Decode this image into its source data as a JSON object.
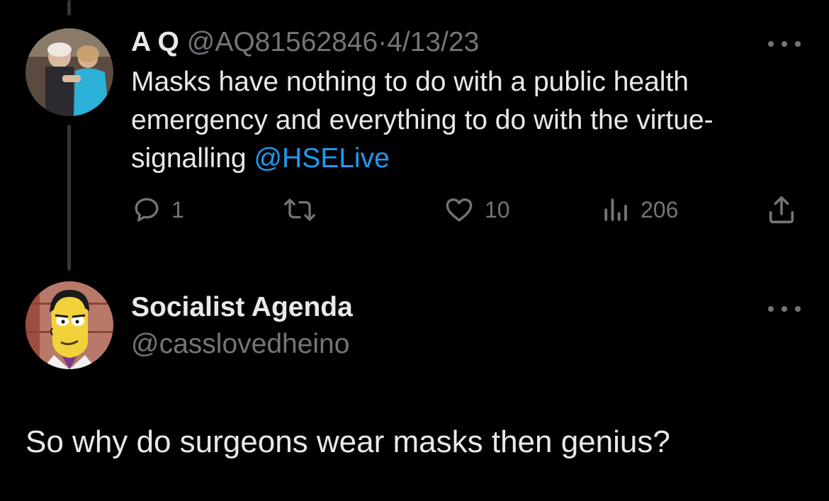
{
  "parent_tweet": {
    "author_name": "A Q",
    "handle": "@AQ81562846",
    "separator": "·",
    "date": "4/13/23",
    "text_before_mention": "Masks have nothing to do with a public health emergency and everything to do with the virtue-signalling",
    "mention": "@HSELive",
    "stats": {
      "replies": "1",
      "likes": "10",
      "views": "206"
    }
  },
  "reply_tweet": {
    "author_name": "Socialist Agenda",
    "handle": "@casslovedheino",
    "text": "So why do surgeons wear masks then genius?"
  },
  "icons": {
    "more": "more-horizontal-icon",
    "reply": "reply-bubble-icon",
    "retweet": "retweet-icon",
    "like": "heart-icon",
    "views": "views-bar-chart-icon",
    "share": "share-upload-icon"
  },
  "colors": {
    "background": "#000000",
    "text": "#e7e9ea",
    "muted": "#71767b",
    "link": "#1d9bf0",
    "thread_line": "#333639"
  }
}
